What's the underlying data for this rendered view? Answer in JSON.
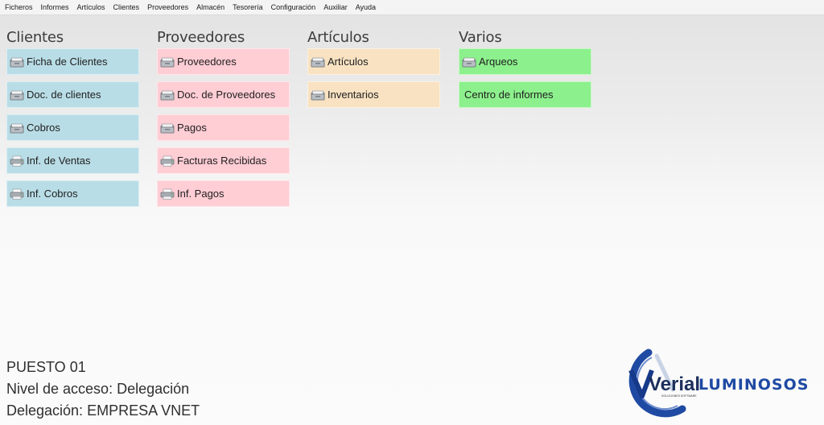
{
  "menu": [
    "Ficheros",
    "Informes",
    "Artículos",
    "Clientes",
    "Proveedores",
    "Almacén",
    "Tesorería",
    "Configuración",
    "Auxiliar",
    "Ayuda"
  ],
  "columns": [
    {
      "title": "Clientes",
      "color": "#b9dde6",
      "items": [
        {
          "label": "Ficha de Clientes",
          "icon": "folder-icon"
        },
        {
          "label": "Doc. de clientes",
          "icon": "folder-icon"
        },
        {
          "label": "Cobros",
          "icon": "folder-icon"
        },
        {
          "label": "Inf. de Ventas",
          "icon": "printer-icon"
        },
        {
          "label": "Inf. Cobros",
          "icon": "printer-icon"
        }
      ]
    },
    {
      "title": "Proveedores",
      "color": "#ffcdd4",
      "items": [
        {
          "label": "Proveedores",
          "icon": "folder-icon"
        },
        {
          "label": "Doc. de Proveedores",
          "icon": "folder-icon"
        },
        {
          "label": "Pagos",
          "icon": "folder-icon"
        },
        {
          "label": "Facturas Recibidas",
          "icon": "printer-icon"
        },
        {
          "label": "Inf. Pagos",
          "icon": "printer-icon"
        }
      ]
    },
    {
      "title": "Artículos",
      "color": "#f8e2c2",
      "items": [
        {
          "label": "Artículos",
          "icon": "folder-icon"
        },
        {
          "label": "Inventarios",
          "icon": "folder-icon"
        }
      ]
    },
    {
      "title": "Varios",
      "color": "#8cf08c",
      "items": [
        {
          "label": "Arqueos",
          "icon": "folder-icon"
        },
        {
          "label": "Centro de informes",
          "icon": ""
        }
      ]
    }
  ],
  "status": {
    "puesto": "PUESTO 01",
    "nivel": "Nivel de acceso: Delegación",
    "delegacion": "Delegación: EMPRESA VNET"
  },
  "logo": {
    "brand": "Verial",
    "tagline": "SOLUCIONES SOFTWARE",
    "partner": "LUMINOSOS",
    "accent": "#1f4aa3"
  }
}
